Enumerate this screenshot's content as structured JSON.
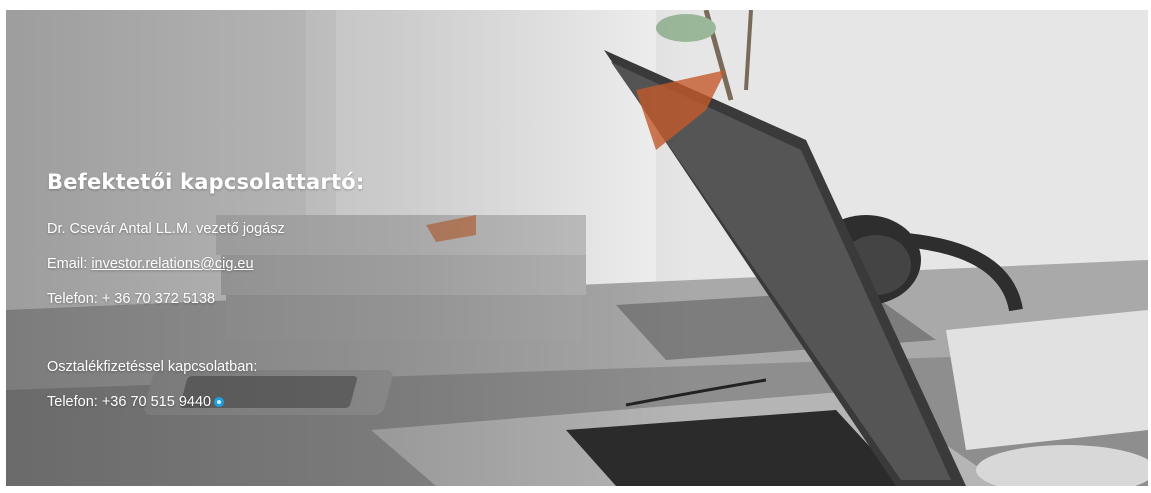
{
  "contact": {
    "heading": "Befektetői kapcsolattartó:",
    "name_line": "Dr. Csevár Antal LL.M. vezető jogász",
    "email_label": "Email: ",
    "email": "investor.relations@cig.eu",
    "phone_line": "Telefon: + 36 70 372 5138",
    "dividend_heading": "Osztalékfizetéssel kapcsolatban:",
    "dividend_phone_line": "Telefon: +36 70 515 9440"
  },
  "icons": {
    "call_icon": "skype-call-icon"
  },
  "colors": {
    "text": "#ffffff",
    "call_icon": "#1e9fe0"
  }
}
